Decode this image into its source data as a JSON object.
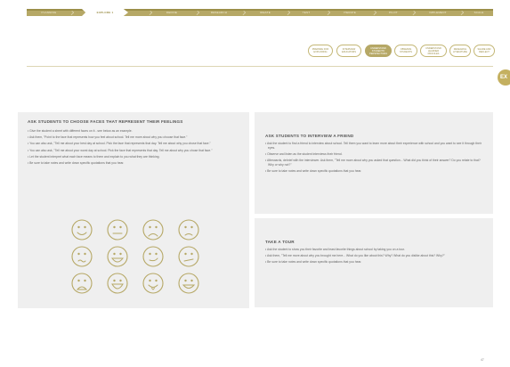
{
  "nav": {
    "crumbs": [
      "PLANNING",
      "EXPLORE 1",
      "DEFINE",
      "RESEARCH",
      "IDEATE",
      "TEST",
      "ITERATE",
      "PILOT",
      "IMPLEMENT",
      "SCALE"
    ],
    "active_index": 1
  },
  "tabs": [
    {
      "label": "PREPARE FOR EXPLORING"
    },
    {
      "label": "INTERVIEW EDUCATORS"
    },
    {
      "label": "UNDERSTAND STUDENTS' PERSPECTIVES",
      "active": true
    },
    {
      "label": "OBSERVE STUDENTS"
    },
    {
      "label": "UNDERSTAND LEARNER PROFILES"
    },
    {
      "label": "RESEARCH LITERATURE"
    },
    {
      "label": "SHARE AND REFLECT"
    }
  ],
  "side_tab": "EX",
  "panels": {
    "faces": {
      "title": "ASK STUDENTS TO CHOOSE FACES THAT REPRESENT THEIR FEELINGS",
      "bullets": [
        "Give the student a sheet with different faces on it - see below as an example.",
        "Ask them, \"Point to the face that represents how you feel about school. Tell me more about why you choose that face.\"",
        "You can also ask, \"Tell me about your best day at school. Pick the face that represents that day. Tell me about why you chose that face.\"",
        "You can also ask, \"Tell me about your worst day at school. Pick the face that represents that day. Tell me about why you chose that face.\"",
        "Let the student interpret what each face means to them and explain to you what they are thinking.",
        "Be sure to take notes and write down specific quotations that you hear."
      ],
      "faces": [
        "smile",
        "neutral",
        "sad",
        "frown",
        "worried",
        "grin",
        "smirk",
        "meh",
        "upset",
        "big-smile",
        "tongue",
        "happy"
      ]
    },
    "friend": {
      "title": "ASK STUDENTS TO INTERVIEW A FRIEND",
      "bullets": [
        "Ask the student to find a friend to interview about school. Tell them you want to learn more about their experience with school and you want to see it through their eyes.",
        "Observe and listen as the student interviews their friend.",
        "Afterwards, debrief with the interviewer. Ask them, \"Tell me more about why you asked that question... What did you think of their answer? Do you relate to that? Why or why not?\"",
        "Be sure to take notes and write down specific quotations that you hear."
      ]
    },
    "tour": {
      "title": "TAKE A TOUR",
      "bullets": [
        "Ask the student to show you their favorite and least favorite things about school by taking you on a tour.",
        "Ask them, \"Tell me more about why you brought me here... What do you like about this? Why? What do you dislike about this? Why?\"",
        "Be sure to take notes and write down specific quotations that you hear."
      ]
    }
  },
  "page_number": "47",
  "colors": {
    "accent": "#b6a866",
    "panel": "#efefef"
  }
}
